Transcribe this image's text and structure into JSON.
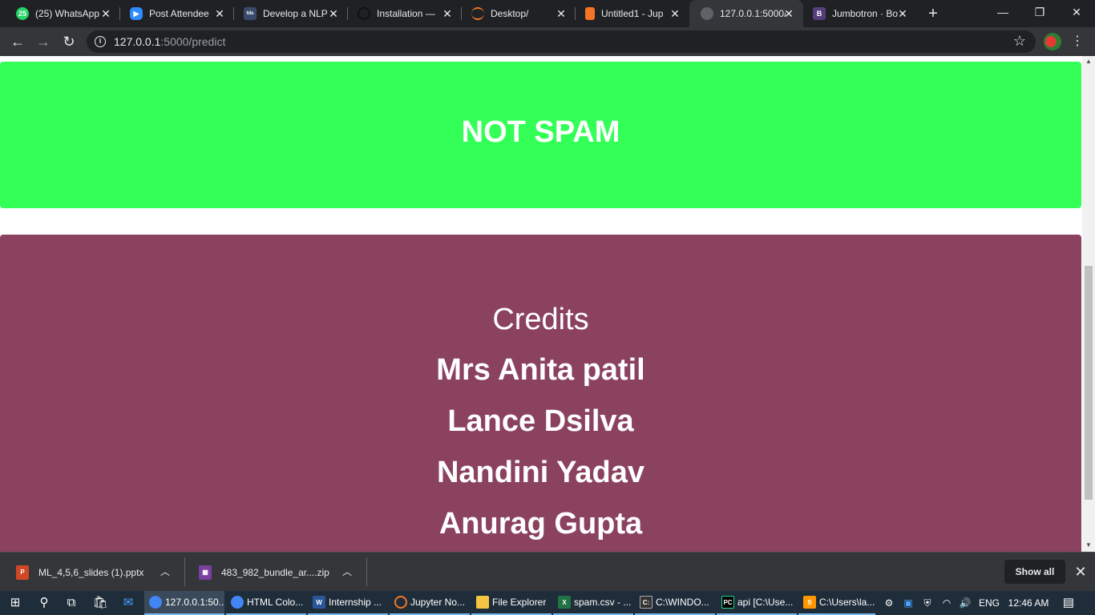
{
  "browser": {
    "tabs": [
      {
        "title": "(25) WhatsApp",
        "icon": "whatsapp-icon",
        "color": "#25d366",
        "glyph": "25"
      },
      {
        "title": "Post Attendee",
        "icon": "zoom-icon",
        "color": "#2d8cff",
        "glyph": "▶"
      },
      {
        "title": "Develop a NLP",
        "icon": "tds-icon",
        "color": "#3b4a6b",
        "glyph": "tds"
      },
      {
        "title": "Installation —",
        "icon": "anaconda-icon",
        "color": "#202124",
        "glyph": "◐"
      },
      {
        "title": "Desktop/",
        "icon": "jupyter-icon",
        "color": "#202124",
        "glyph": "◠"
      },
      {
        "title": "Untitled1 - Jup",
        "icon": "notebook-icon",
        "color": "#f37626",
        "glyph": "▮"
      },
      {
        "title": "127.0.0.1:5000/",
        "icon": "globe-icon",
        "color": "#5f6368",
        "glyph": "◎"
      },
      {
        "title": "Jumbotron · Bo",
        "icon": "bootstrap-icon",
        "color": "#563d7c",
        "glyph": "B"
      }
    ],
    "url_host": "127.0.0.1",
    "url_path": ":5000/predict"
  },
  "page": {
    "result": "NOT SPAM",
    "credits_title": "Credits",
    "credits": [
      "Mrs Anita patil",
      "Lance Dsilva",
      "Nandini Yadav",
      "Anurag Gupta"
    ],
    "colors": {
      "result_bg": "#33ff57",
      "credits_bg": "#8b425e"
    }
  },
  "downloads": {
    "items": [
      {
        "name": "ML_4,5,6_slides (1).pptx",
        "icon": "powerpoint-icon",
        "color": "#d24726",
        "glyph": "P"
      },
      {
        "name": "483_982_bundle_ar....zip",
        "icon": "winrar-icon",
        "color": "#7b3fa0",
        "glyph": "▦"
      }
    ],
    "show_all": "Show all"
  },
  "taskbar": {
    "apps": [
      {
        "label": "127.0.0.1:50...",
        "icon": "chrome-icon",
        "color": "#4285f4"
      },
      {
        "label": "HTML Colo...",
        "icon": "chrome-icon",
        "color": "#4285f4"
      },
      {
        "label": "Internship ...",
        "icon": "word-icon",
        "color": "#2b579a"
      },
      {
        "label": "Jupyter No...",
        "icon": "jupyter-icon",
        "color": "#f37626"
      },
      {
        "label": "File Explorer",
        "icon": "folder-icon",
        "color": "#f4c542"
      },
      {
        "label": "spam.csv - ...",
        "icon": "excel-icon",
        "color": "#217346"
      },
      {
        "label": "C:\\WINDO...",
        "icon": "cmd-icon",
        "color": "#333333"
      },
      {
        "label": "api [C:\\Use...",
        "icon": "pycharm-icon",
        "color": "#21d789"
      },
      {
        "label": "C:\\Users\\la...",
        "icon": "sublime-icon",
        "color": "#ff9800"
      }
    ],
    "language": "ENG",
    "time": "12:46 AM"
  }
}
